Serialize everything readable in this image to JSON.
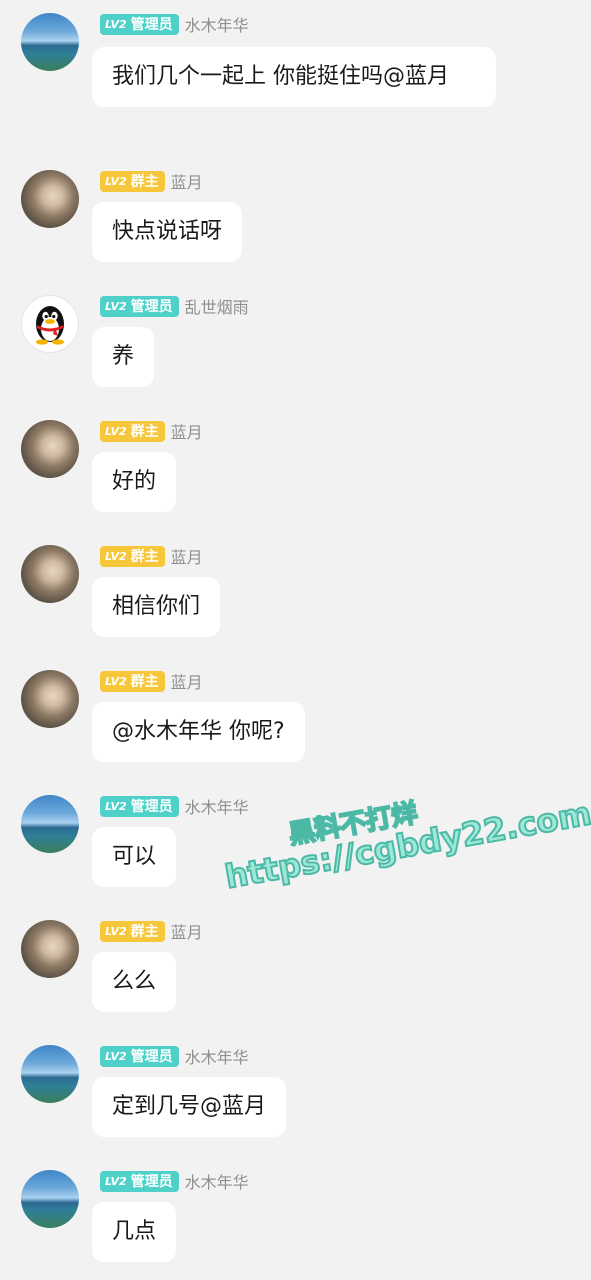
{
  "messages": [
    {
      "role": "管理员",
      "level": "LV2",
      "nick": "水木年华",
      "avatar": "sky-landscape-avatar",
      "text": "我们几个一起上  你能挺住吗@蓝月"
    },
    {
      "role": "群主",
      "level": "LV2",
      "nick": "蓝月",
      "avatar": "person-photo-avatar",
      "text": "快点说话呀"
    },
    {
      "role": "管理员",
      "level": "LV2",
      "nick": "乱世烟雨",
      "avatar": "qq-penguin-avatar",
      "text": "养"
    },
    {
      "role": "群主",
      "level": "LV2",
      "nick": "蓝月",
      "avatar": "person-photo-avatar",
      "text": "好的"
    },
    {
      "role": "群主",
      "level": "LV2",
      "nick": "蓝月",
      "avatar": "person-photo-avatar",
      "text": "相信你们"
    },
    {
      "role": "群主",
      "level": "LV2",
      "nick": "蓝月",
      "avatar": "person-photo-avatar",
      "text": "@水木年华 你呢?"
    },
    {
      "role": "管理员",
      "level": "LV2",
      "nick": "水木年华",
      "avatar": "sky-landscape-avatar",
      "text": "可以"
    },
    {
      "role": "群主",
      "level": "LV2",
      "nick": "蓝月",
      "avatar": "person-photo-avatar",
      "text": "么么"
    },
    {
      "role": "管理员",
      "level": "LV2",
      "nick": "水木年华",
      "avatar": "sky-landscape-avatar",
      "text": "定到几号@蓝月"
    },
    {
      "role": "管理员",
      "level": "LV2",
      "nick": "水木年华",
      "avatar": "sky-landscape-avatar",
      "text": "几点"
    }
  ],
  "watermark": {
    "line1": "黑料不打烊",
    "line2": "https://cgbdy22.com"
  },
  "colors": {
    "background": "#f2f2f2",
    "bubble": "#ffffff",
    "admin_badge": "#4fd0c9",
    "owner_badge": "#f6c63b",
    "nickname": "#8f8f8f",
    "watermark_fill": "#9de8d8",
    "watermark_stroke": "#4bb9a6"
  }
}
